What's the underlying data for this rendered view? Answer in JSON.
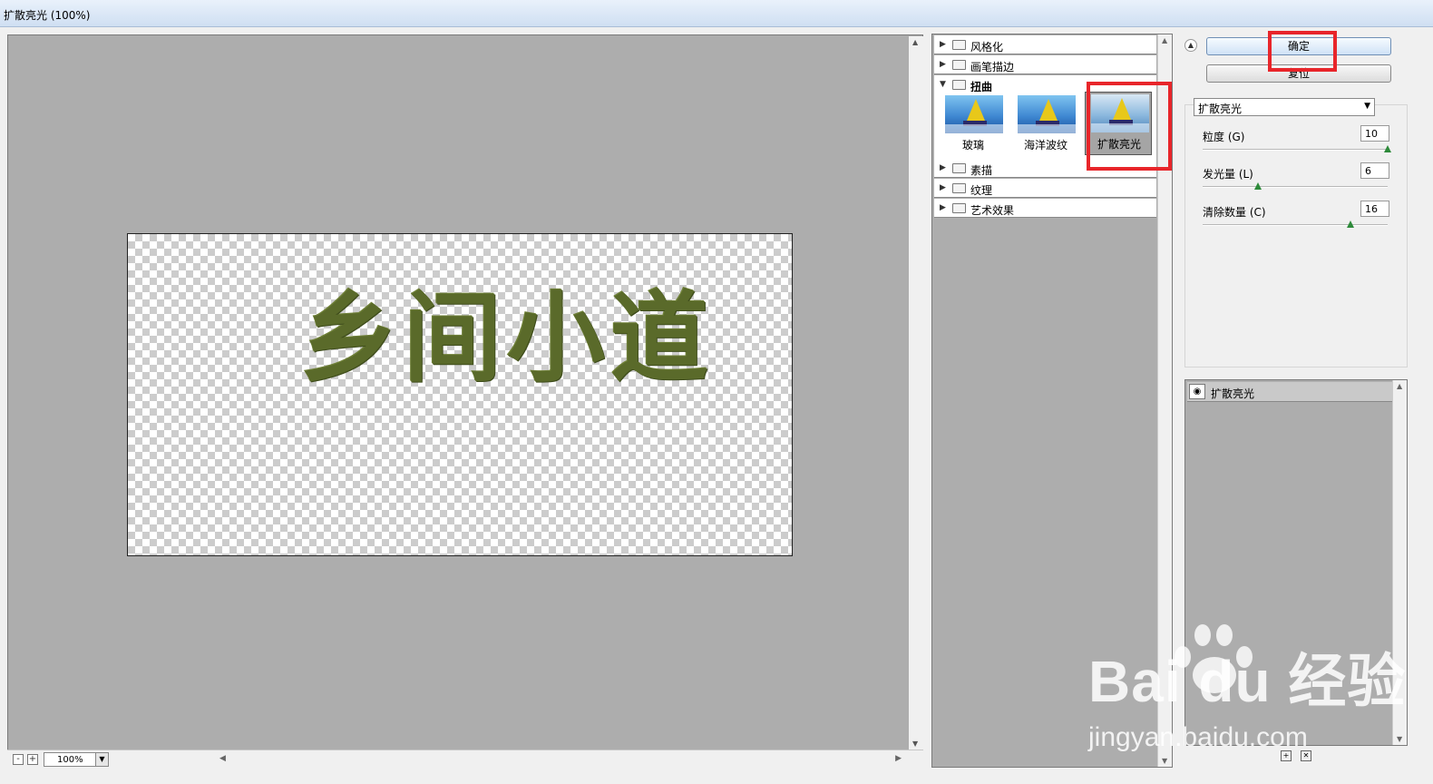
{
  "window": {
    "title": "扩散亮光 (100%)"
  },
  "preview": {
    "canvas_text": "乡间小道",
    "zoom_value": "100%",
    "zoom_out_label": "-",
    "zoom_in_label": "+"
  },
  "gallery": {
    "categories": [
      {
        "label": "风格化",
        "open": false
      },
      {
        "label": "画笔描边",
        "open": false
      },
      {
        "label": "扭曲",
        "open": true
      },
      {
        "label": "素描",
        "open": false
      },
      {
        "label": "纹理",
        "open": false
      },
      {
        "label": "艺术效果",
        "open": false
      }
    ],
    "filters": [
      {
        "label": "玻璃",
        "selected": false
      },
      {
        "label": "海洋波纹",
        "selected": false
      },
      {
        "label": "扩散亮光",
        "selected": true
      }
    ]
  },
  "panel": {
    "ok_label": "确定",
    "reset_label": "复位",
    "filter_select_value": "扩散亮光",
    "params": [
      {
        "label": "粒度 (G)",
        "value": "10",
        "fraction": 1.0
      },
      {
        "label": "发光量 (L)",
        "value": "6",
        "fraction": 0.3
      },
      {
        "label": "清除数量 (C)",
        "value": "16",
        "fraction": 0.8
      }
    ],
    "layer_name": "扩散亮光"
  },
  "watermark": {
    "brand": "Bai du 经验",
    "url": "jingyan.baidu.com"
  },
  "colors": {
    "highlight": "#e8252a",
    "text_fill": "#5a6a2a",
    "slider_knob": "#2d8a3a"
  }
}
